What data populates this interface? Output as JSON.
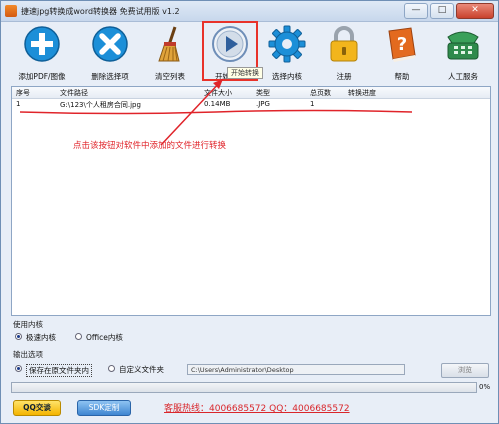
{
  "window": {
    "title": "捷速jpg转换成word转换器 免费试用版 v1.2",
    "min_label": "—",
    "max_label": "□",
    "close_label": "✕"
  },
  "toolbar": {
    "items": [
      {
        "label": "添加PDF/图像",
        "icon": "plus-icon",
        "color": "#1c8fd8"
      },
      {
        "label": "删除选择项",
        "icon": "x-icon",
        "color": "#1c8fd8"
      },
      {
        "label": "清空列表",
        "icon": "broom-icon",
        "color": "#c9862b"
      },
      {
        "label": "开始转换",
        "icon": "play-icon",
        "color": "#3b6ea8"
      },
      {
        "label": "选择内核",
        "icon": "gear-icon",
        "color": "#1c8fd8"
      },
      {
        "label": "注册",
        "icon": "lock-icon",
        "color": "#f2b51c"
      },
      {
        "label": "帮助",
        "icon": "help-book-icon",
        "color": "#e36a1e"
      },
      {
        "label": "人工服务",
        "icon": "phone-icon",
        "color": "#2f8a4c"
      }
    ],
    "tooltip": "开始转换"
  },
  "grid": {
    "headers": [
      "序号",
      "文件路径",
      "文件大小",
      "类型",
      "总页数",
      "转换进度"
    ],
    "rows": [
      [
        "1",
        "G:\\123\\个人租房合同.jpg",
        "0.14MB",
        ".JPG",
        "1",
        ""
      ]
    ]
  },
  "annotation": "点击该按钮对软件中添加的文件进行转换",
  "options": {
    "kernel_title": "使用内核",
    "kernel_fast": "极速内核",
    "kernel_office": "Office内核",
    "output_title": "输出选项",
    "save_original": "保存在原文件夹内",
    "custom_folder": "自定义文件夹",
    "path": "C:\\Users\\Administrator\\Desktop",
    "browse_label": "浏览",
    "progress": 0,
    "progress_label": "0%"
  },
  "footer": {
    "qq_label": "QQ交谈",
    "sdk_label": "SDK定制",
    "hotline": "客服热线：4006685572 QQ：4006685572"
  },
  "colors": {
    "annotation": "#e0242a",
    "highlight": "#e8322a"
  }
}
